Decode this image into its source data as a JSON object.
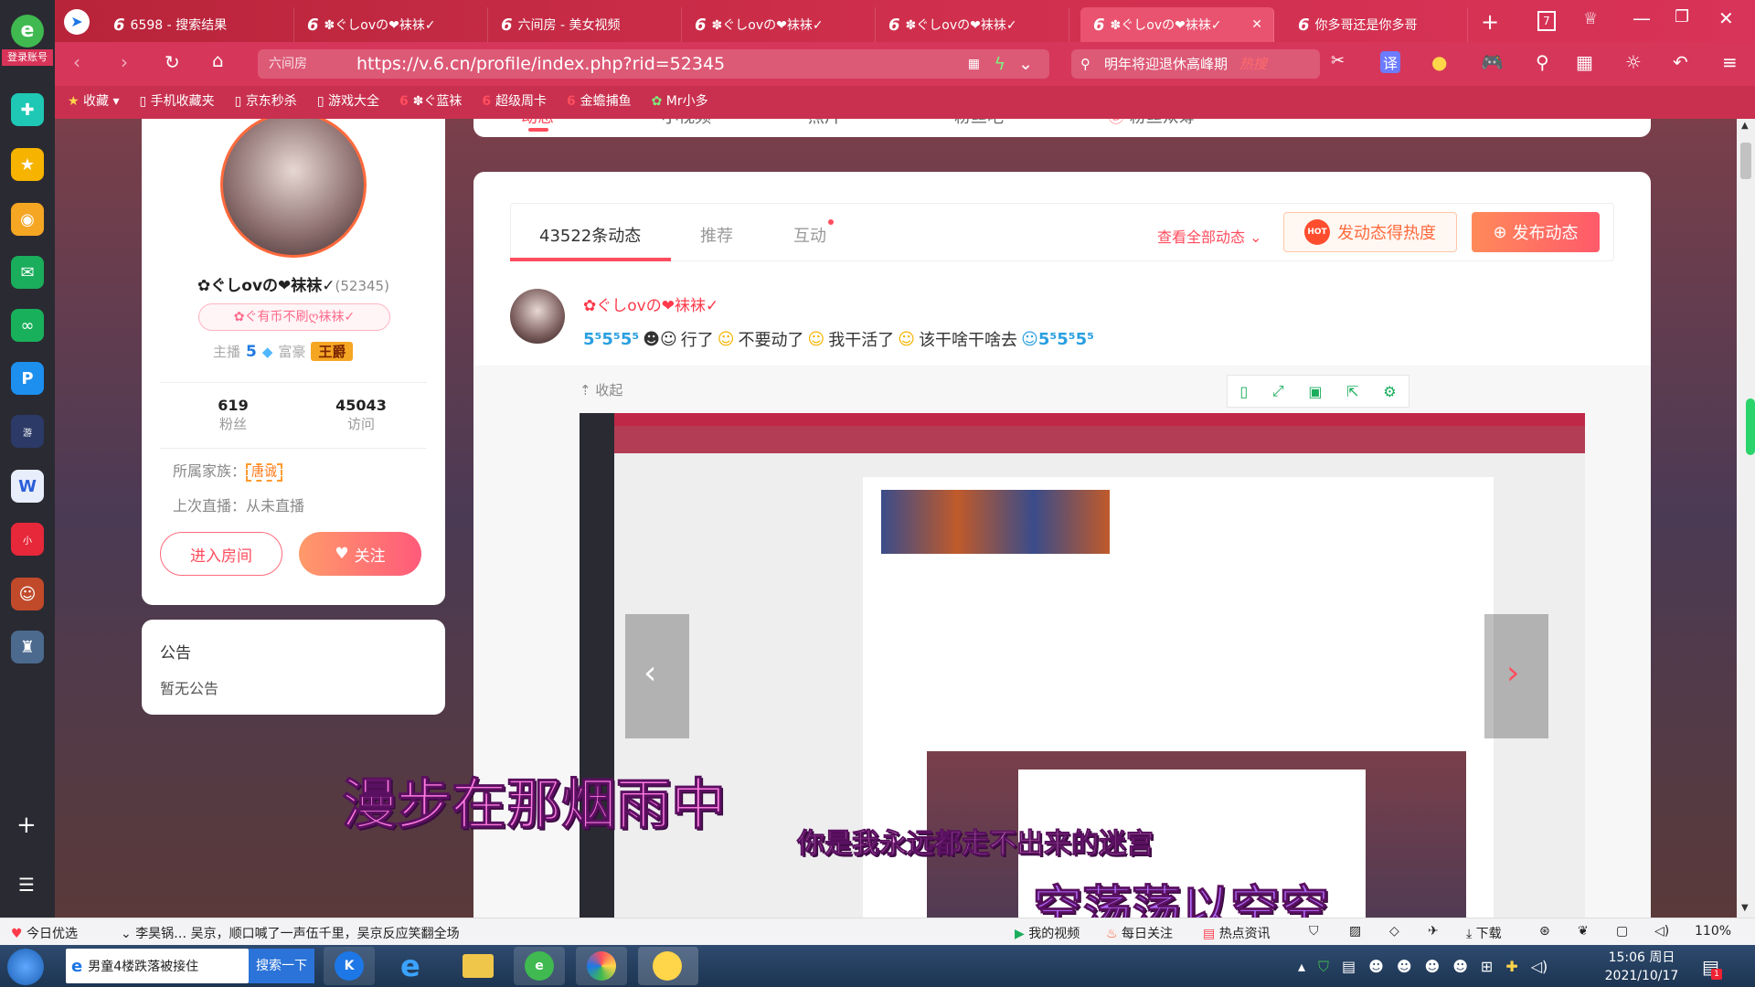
{
  "browser": {
    "login_label": "登录账号",
    "tabs": [
      {
        "label": "6598 - 搜索结果",
        "active": false
      },
      {
        "label": "✽ぐしovの❤袜袜✓",
        "active": false
      },
      {
        "label": "六间房 - 美女视频",
        "active": false
      },
      {
        "label": "✽ぐしovの❤袜袜✓",
        "active": false
      },
      {
        "label": "✽ぐしovの❤袜袜✓",
        "active": false
      },
      {
        "label": "✽ぐしovの❤袜袜✓",
        "active": true
      },
      {
        "label": "你多哥还是你多哥",
        "active": false
      }
    ],
    "tab_count": "7",
    "url_site": "六间房",
    "url": "https://v.6.cn/profile/index.php?rid=52345",
    "search_text": "明年将迎退休高峰期",
    "search_badge": "热搜",
    "bookmarks": [
      "收藏",
      "手机收藏夹",
      "京东秒杀",
      "游戏大全",
      "✽ぐ蓝袜",
      "超级周卡",
      "金蟾捕鱼",
      "Mr小多"
    ]
  },
  "profile": {
    "name": "✿ぐしovの❤袜袜✓",
    "rid": "(52345)",
    "tag": "✿ぐ有币不刷ღ袜袜✓",
    "anchor_label": "主播",
    "anchor_level": "5",
    "rich_label": "富豪",
    "rich_level": "王爵",
    "fans_count": "619",
    "fans_label": "粉丝",
    "visit_count": "45043",
    "visit_label": "访问",
    "family_label": "所属家族：",
    "family_value": "唐诚",
    "last_live": "上次直播：从未直播",
    "enter_room": "进入房间",
    "follow": "关注"
  },
  "notice": {
    "title": "公告",
    "body": "暂无公告"
  },
  "nav_tabs": [
    "动态",
    "小视频",
    "照片",
    "粉丝吧",
    "粉丝众筹"
  ],
  "feed": {
    "tabs": [
      "43522条动态",
      "推荐",
      "互动"
    ],
    "view_all": "查看全部动态",
    "hot_button": "发动态得热度",
    "hot_badge": "HOT",
    "post_button": "发布动态",
    "post_author": "✿ぐしovの❤袜袜✓",
    "post_text_parts": [
      "行了",
      "不要动了",
      "我干活了",
      "该干啥干啥去"
    ],
    "collapse": "收起"
  },
  "lyrics": {
    "line1": "漫步在那烟雨中",
    "line2": "你是我永远都走不出来的迷宫",
    "line3": "空荡荡以空空"
  },
  "status": {
    "today": "今日优选",
    "news": "李昊锅… 吴京，顺口喊了一声伍千里，吴京反应笑翻全场",
    "items": [
      "我的视频",
      "每日关注",
      "热点资讯",
      "下载"
    ],
    "zoom": "110%"
  },
  "taskbar": {
    "search_item": "男童4楼跌落被接住",
    "search_btn": "搜索一下",
    "time": "15:06 周日",
    "date": "2021/10/17"
  },
  "colors": {
    "accent": "#ff4d5e",
    "orange": "#ff7a45",
    "brand": "#d83358"
  }
}
